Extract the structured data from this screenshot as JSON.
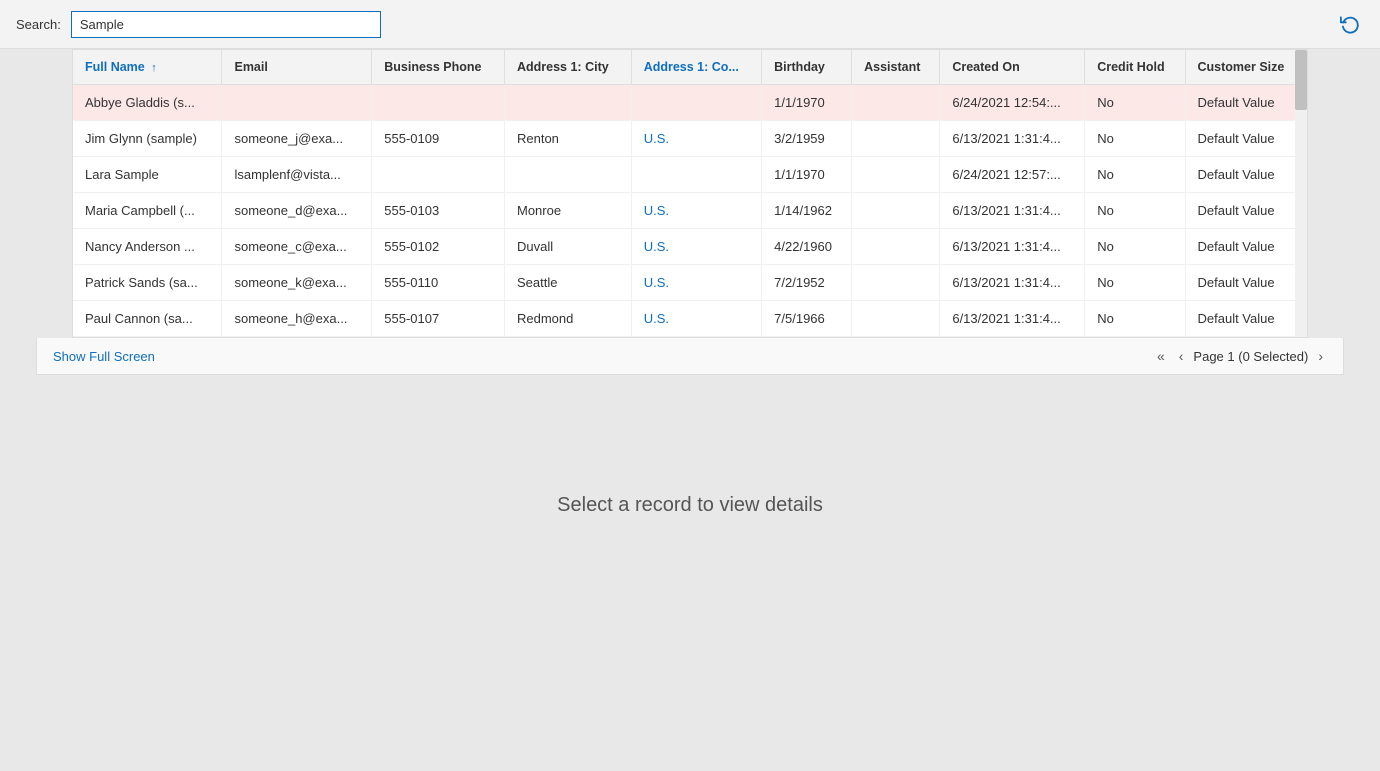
{
  "search": {
    "label": "Search:",
    "value": "Sample",
    "placeholder": ""
  },
  "refresh_icon": "↻",
  "table": {
    "columns": [
      {
        "key": "fullName",
        "label": "Full Name",
        "sorted": true,
        "sortDir": "↑"
      },
      {
        "key": "email",
        "label": "Email",
        "sorted": false
      },
      {
        "key": "businessPhone",
        "label": "Business Phone",
        "sorted": false
      },
      {
        "key": "addressCity",
        "label": "Address 1: City",
        "sorted": false
      },
      {
        "key": "addressCountry",
        "label": "Address 1: Co...",
        "sorted": false,
        "link": true
      },
      {
        "key": "birthday",
        "label": "Birthday",
        "sorted": false
      },
      {
        "key": "assistant",
        "label": "Assistant",
        "sorted": false
      },
      {
        "key": "createdOn",
        "label": "Created On",
        "sorted": false
      },
      {
        "key": "creditHold",
        "label": "Credit Hold",
        "sorted": false
      },
      {
        "key": "customerSize",
        "label": "Customer Size",
        "sorted": false
      }
    ],
    "rows": [
      {
        "highlighted": true,
        "fullName": "Abbye Gladdis (s...",
        "email": "",
        "businessPhone": "",
        "addressCity": "",
        "addressCountry": "",
        "birthday": "1/1/1970",
        "assistant": "",
        "createdOn": "6/24/2021 12:54:...",
        "creditHold": "No",
        "customerSize": "Default Value"
      },
      {
        "highlighted": false,
        "fullName": "Jim Glynn (sample)",
        "email": "someone_j@exa...",
        "businessPhone": "555-0109",
        "addressCity": "Renton",
        "addressCountry": "U.S.",
        "birthday": "3/2/1959",
        "assistant": "",
        "createdOn": "6/13/2021 1:31:4...",
        "creditHold": "No",
        "customerSize": "Default Value"
      },
      {
        "highlighted": false,
        "fullName": "Lara Sample",
        "email": "lsamplenf@vista...",
        "businessPhone": "",
        "addressCity": "",
        "addressCountry": "",
        "birthday": "1/1/1970",
        "assistant": "",
        "createdOn": "6/24/2021 12:57:...",
        "creditHold": "No",
        "customerSize": "Default Value"
      },
      {
        "highlighted": false,
        "fullName": "Maria Campbell (...",
        "email": "someone_d@exa...",
        "businessPhone": "555-0103",
        "addressCity": "Monroe",
        "addressCountry": "U.S.",
        "birthday": "1/14/1962",
        "assistant": "",
        "createdOn": "6/13/2021 1:31:4...",
        "creditHold": "No",
        "customerSize": "Default Value"
      },
      {
        "highlighted": false,
        "fullName": "Nancy Anderson ...",
        "email": "someone_c@exa...",
        "businessPhone": "555-0102",
        "addressCity": "Duvall",
        "addressCountry": "U.S.",
        "birthday": "4/22/1960",
        "assistant": "",
        "createdOn": "6/13/2021 1:31:4...",
        "creditHold": "No",
        "customerSize": "Default Value"
      },
      {
        "highlighted": false,
        "fullName": "Patrick Sands (sa...",
        "email": "someone_k@exa...",
        "businessPhone": "555-0110",
        "addressCity": "Seattle",
        "addressCountry": "U.S.",
        "birthday": "7/2/1952",
        "assistant": "",
        "createdOn": "6/13/2021 1:31:4...",
        "creditHold": "No",
        "customerSize": "Default Value"
      },
      {
        "highlighted": false,
        "fullName": "Paul Cannon (sa...",
        "email": "someone_h@exa...",
        "businessPhone": "555-0107",
        "addressCity": "Redmond",
        "addressCountry": "U.S.",
        "birthday": "7/5/1966",
        "assistant": "",
        "createdOn": "6/13/2021 1:31:4...",
        "creditHold": "No",
        "customerSize": "Default Value"
      }
    ]
  },
  "footer": {
    "show_full_screen": "Show Full Screen",
    "pagination_text": "Page 1 (0 Selected)"
  },
  "empty_state": {
    "message": "Select a record to view details"
  },
  "colors": {
    "link": "#106ebe",
    "highlight_bg": "#fde8e8",
    "accent": "#106ebe"
  }
}
